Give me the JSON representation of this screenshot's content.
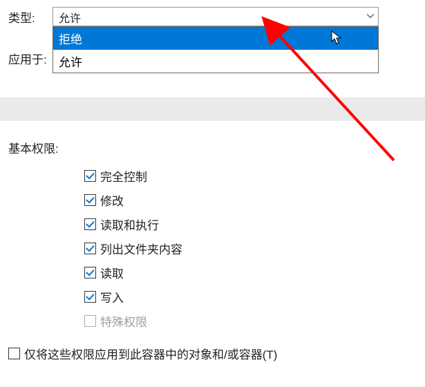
{
  "labels": {
    "type": "类型:",
    "applies_to": "应用于:"
  },
  "type_dropdown": {
    "selected": "允许",
    "options": [
      {
        "label": "拒绝",
        "highlighted": true
      },
      {
        "label": "允许",
        "highlighted": false
      }
    ]
  },
  "section": {
    "title": "基本权限:"
  },
  "permissions": [
    {
      "label": "完全控制",
      "checked": true,
      "disabled": false
    },
    {
      "label": "修改",
      "checked": true,
      "disabled": false
    },
    {
      "label": "读取和执行",
      "checked": true,
      "disabled": false
    },
    {
      "label": "列出文件夹内容",
      "checked": true,
      "disabled": false
    },
    {
      "label": "读取",
      "checked": true,
      "disabled": false
    },
    {
      "label": "写入",
      "checked": true,
      "disabled": false
    },
    {
      "label": "特殊权限",
      "checked": false,
      "disabled": true
    }
  ],
  "apply_only": {
    "label": "仅将这些权限应用到此容器中的对象和/或容器(T)",
    "checked": false
  }
}
